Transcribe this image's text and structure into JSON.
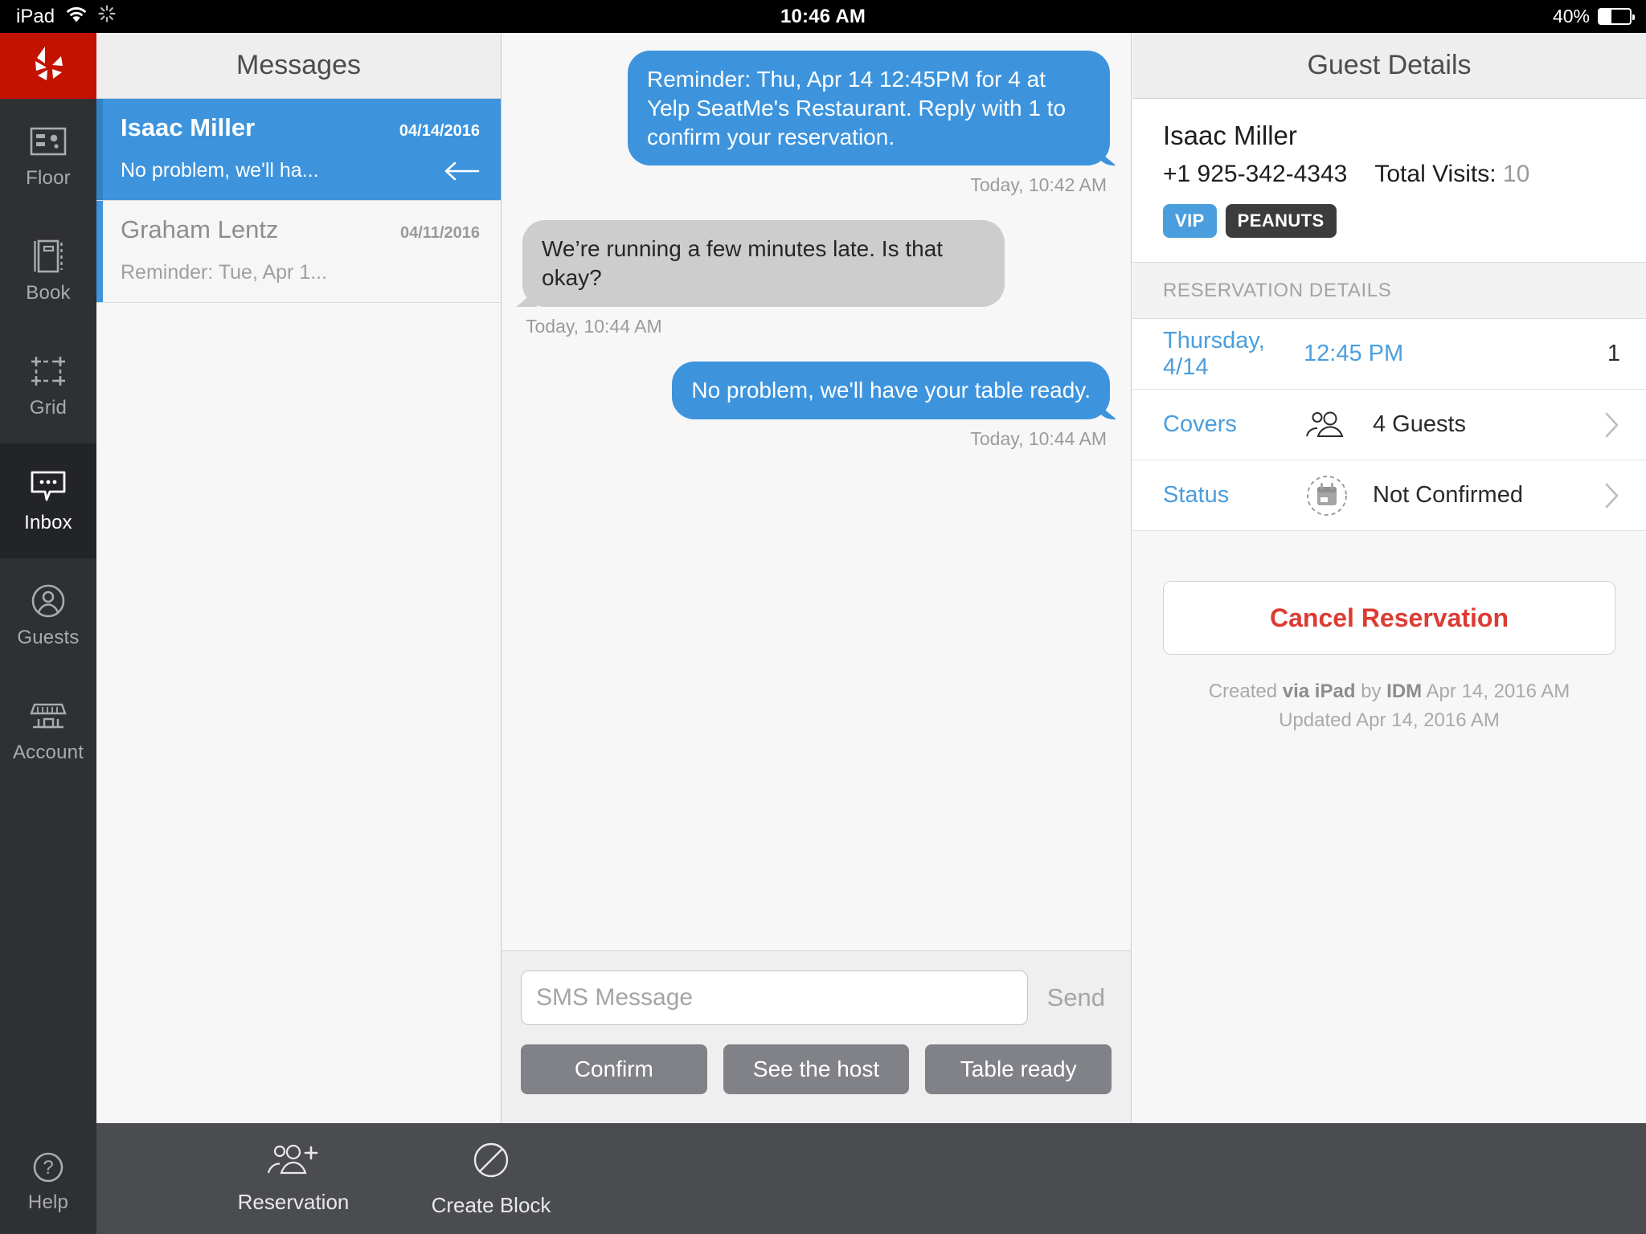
{
  "status_bar": {
    "device": "iPad",
    "wifi_icon": "wifi-icon",
    "sync_icon": "sync-spinner-icon",
    "time": "10:46 AM",
    "battery_percent": "40%"
  },
  "rail": {
    "logo": "yelp-logo",
    "items": [
      {
        "label": "Floor",
        "icon": "floor-plan-icon",
        "active": false
      },
      {
        "label": "Book",
        "icon": "book-icon",
        "active": false
      },
      {
        "label": "Grid",
        "icon": "grid-icon",
        "active": false
      },
      {
        "label": "Inbox",
        "icon": "chat-bubble-icon",
        "active": true
      },
      {
        "label": "Guests",
        "icon": "person-circle-icon",
        "active": false
      },
      {
        "label": "Account",
        "icon": "storefront-icon",
        "active": false
      }
    ],
    "help": {
      "label": "Help",
      "icon": "question-circle-icon"
    }
  },
  "messages_panel": {
    "title": "Messages",
    "conversations": [
      {
        "name": "Isaac Miller",
        "date": "04/14/2016",
        "preview": "No problem, we'll ha...",
        "selected": true,
        "arrow_icon": "arrow-left-icon"
      },
      {
        "name": "Graham Lentz",
        "date": "04/11/2016",
        "preview": "Reminder: Tue, Apr 1...",
        "selected": false
      }
    ]
  },
  "chat": {
    "messages": [
      {
        "direction": "out",
        "text": "Reminder: Thu, Apr 14 12:45PM for 4 at Yelp SeatMe's Restaurant. Reply with 1 to confirm your reservation.",
        "timestamp": "Today, 10:42 AM"
      },
      {
        "direction": "in",
        "text": "We’re running a few minutes late. Is that okay?",
        "timestamp": "Today, 10:44 AM"
      },
      {
        "direction": "out",
        "text": "No problem, we'll have your table ready.",
        "timestamp": "Today, 10:44 AM"
      }
    ],
    "composer": {
      "placeholder": "SMS Message",
      "value": "",
      "send_label": "Send",
      "quick_replies": [
        "Confirm",
        "See the host",
        "Table ready"
      ]
    }
  },
  "guest_details": {
    "title": "Guest Details",
    "name": "Isaac Miller",
    "phone": "+1 925-342-4343",
    "visits_label": "Total Visits:",
    "visits_value": "10",
    "tags": [
      {
        "label": "VIP",
        "kind": "vip"
      },
      {
        "label": "PEANUTS",
        "kind": "allergy"
      }
    ],
    "section_title": "RESERVATION DETAILS",
    "reservation": {
      "date": "Thursday, 4/14",
      "time": "12:45 PM",
      "table": "1",
      "covers_label": "Covers",
      "covers_icon": "two-people-icon",
      "covers_value": "4 Guests",
      "status_label": "Status",
      "status_icon": "dashed-calendar-icon",
      "status_value": "Not Confirmed",
      "chevron_icon": "chevron-right-icon"
    },
    "cancel_label": "Cancel Reservation",
    "created_prefix": "Created ",
    "created_via": "via iPad",
    "created_by_word": " by ",
    "created_by": "IDM",
    "created_date": " Apr 14, 2016 AM",
    "updated_line": "Updated Apr 14, 2016 AM"
  },
  "bottom_bar": {
    "items": [
      {
        "label": "Reservation",
        "icon": "add-people-icon"
      },
      {
        "label": "Create Block",
        "icon": "block-circle-icon"
      }
    ]
  },
  "colors": {
    "yelp_red": "#c41200",
    "accent_blue": "#3d94dd",
    "danger_red": "#dd3b33",
    "rail_dark": "#2f3033"
  }
}
